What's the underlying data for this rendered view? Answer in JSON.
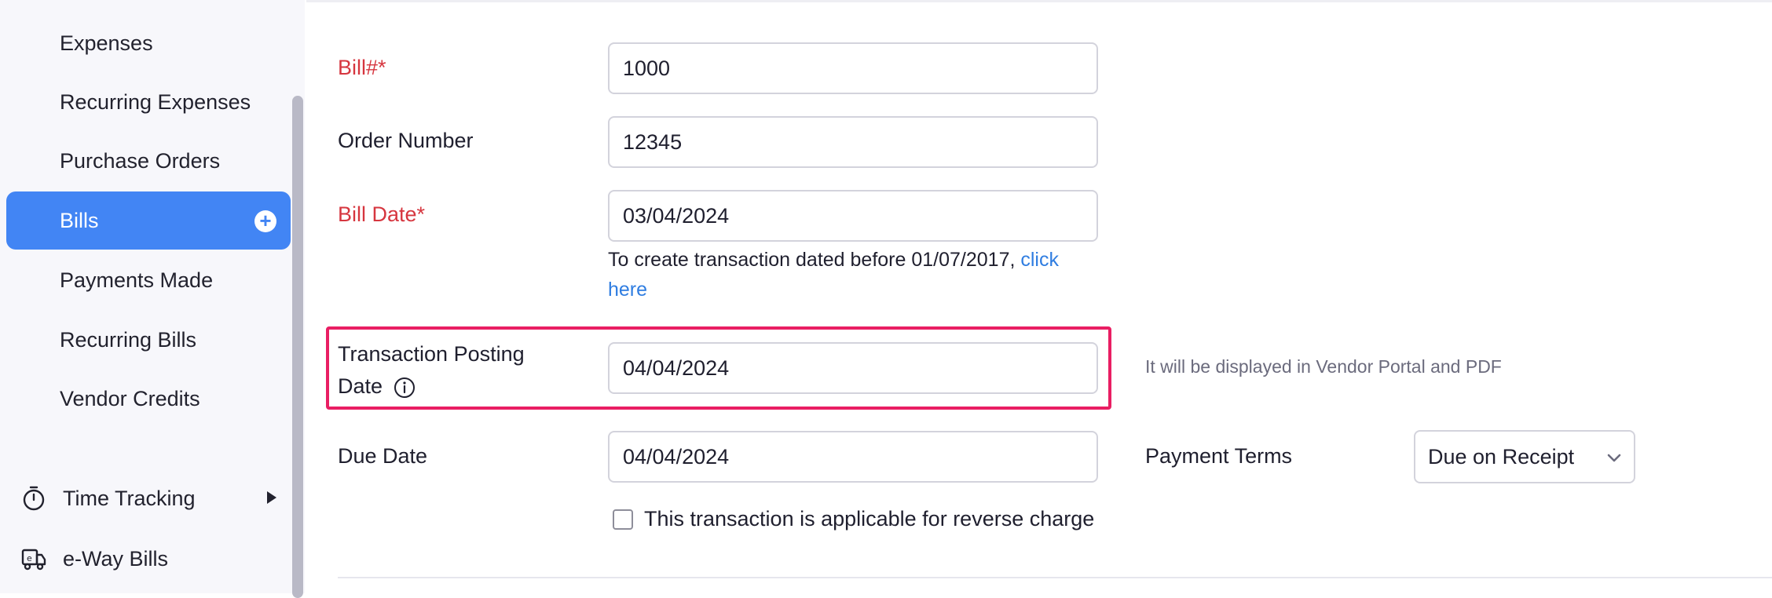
{
  "sidebar": {
    "items": [
      {
        "label": "Expenses"
      },
      {
        "label": "Recurring Expenses"
      },
      {
        "label": "Purchase Orders"
      },
      {
        "label": "Bills"
      },
      {
        "label": "Payments Made"
      },
      {
        "label": "Recurring Bills"
      },
      {
        "label": "Vendor Credits"
      }
    ],
    "active": "Bills",
    "groups": [
      {
        "label": "Time Tracking",
        "icon": "stopwatch-icon"
      },
      {
        "label": "e-Way Bills",
        "icon": "truck-icon"
      }
    ]
  },
  "form": {
    "bill_label": "Bill#*",
    "bill_value": "1000",
    "order_label": "Order Number",
    "order_value": "12345",
    "bill_date_label": "Bill Date*",
    "bill_date_value": "03/04/2024",
    "bill_date_hint": "To create transaction dated before 01/07/2017,",
    "bill_date_hint_link": "click here",
    "posting_label": "Transaction Posting Date",
    "posting_value": "04/04/2024",
    "posting_note": "It will be displayed in Vendor Portal and PDF",
    "due_label": "Due Date",
    "due_value": "04/04/2024",
    "terms_label": "Payment Terms",
    "terms_value": "Due on Receipt",
    "reverse_charge_label": "This transaction is applicable for reverse charge",
    "reverse_charge_checked": false
  },
  "colors": {
    "accent": "#4285f4",
    "required": "#d6363f",
    "highlight": "#e91e63",
    "link": "#2f7de1"
  }
}
